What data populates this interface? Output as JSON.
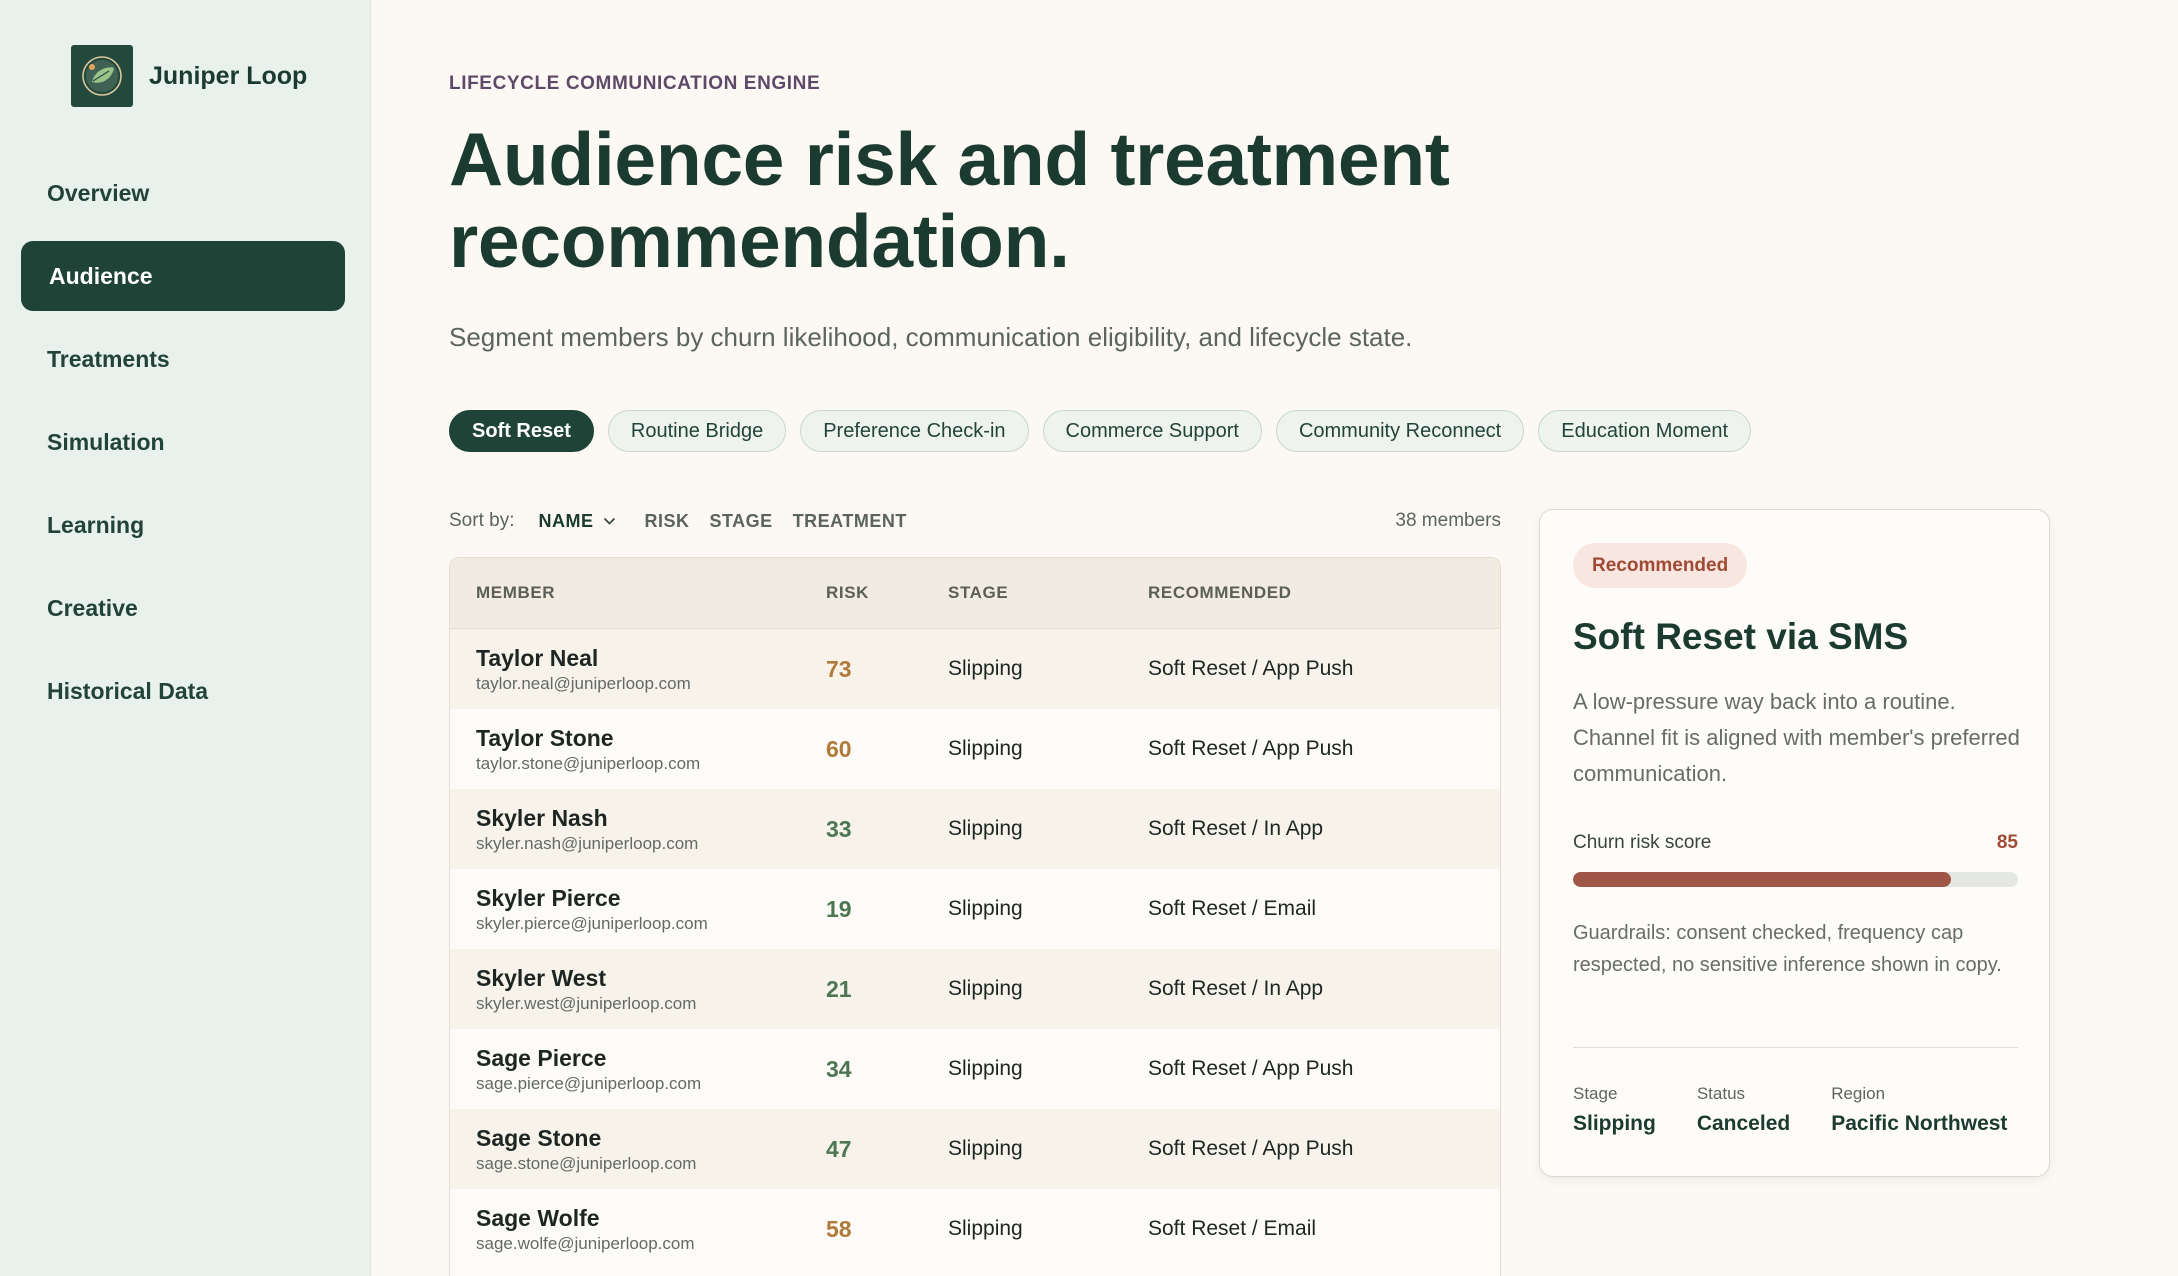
{
  "brand": {
    "name": "Juniper Loop"
  },
  "nav": {
    "items": [
      {
        "label": "Overview",
        "active": false
      },
      {
        "label": "Audience",
        "active": true
      },
      {
        "label": "Treatments",
        "active": false
      },
      {
        "label": "Simulation",
        "active": false
      },
      {
        "label": "Learning",
        "active": false
      },
      {
        "label": "Creative",
        "active": false
      },
      {
        "label": "Historical Data",
        "active": false
      }
    ]
  },
  "header": {
    "eyebrow": "LIFECYCLE COMMUNICATION ENGINE",
    "title": "Audience risk and treatment recommendation.",
    "subtitle": "Segment members by churn likelihood, communication eligibility, and lifecycle state."
  },
  "chips": [
    {
      "label": "Soft Reset",
      "active": true
    },
    {
      "label": "Routine Bridge",
      "active": false
    },
    {
      "label": "Preference Check-in",
      "active": false
    },
    {
      "label": "Commerce Support",
      "active": false
    },
    {
      "label": "Community Reconnect",
      "active": false
    },
    {
      "label": "Education Moment",
      "active": false
    }
  ],
  "sort": {
    "label": "Sort by:",
    "options": [
      "NAME",
      "RISK",
      "STAGE",
      "TREATMENT"
    ],
    "active": "NAME",
    "count": "38 members"
  },
  "table": {
    "headers": [
      "MEMBER",
      "RISK",
      "STAGE",
      "RECOMMENDED"
    ],
    "rows": [
      {
        "name": "Taylor Neal",
        "email": "taylor.neal@juniperloop.com",
        "risk": "73",
        "level": "high",
        "stage": "Slipping",
        "recommended": "Soft Reset / App Push"
      },
      {
        "name": "Taylor Stone",
        "email": "taylor.stone@juniperloop.com",
        "risk": "60",
        "level": "high",
        "stage": "Slipping",
        "recommended": "Soft Reset / App Push"
      },
      {
        "name": "Skyler Nash",
        "email": "skyler.nash@juniperloop.com",
        "risk": "33",
        "level": "low",
        "stage": "Slipping",
        "recommended": "Soft Reset / In App"
      },
      {
        "name": "Skyler Pierce",
        "email": "skyler.pierce@juniperloop.com",
        "risk": "19",
        "level": "low",
        "stage": "Slipping",
        "recommended": "Soft Reset / Email"
      },
      {
        "name": "Skyler West",
        "email": "skyler.west@juniperloop.com",
        "risk": "21",
        "level": "low",
        "stage": "Slipping",
        "recommended": "Soft Reset / In App"
      },
      {
        "name": "Sage Pierce",
        "email": "sage.pierce@juniperloop.com",
        "risk": "34",
        "level": "low",
        "stage": "Slipping",
        "recommended": "Soft Reset / App Push"
      },
      {
        "name": "Sage Stone",
        "email": "sage.stone@juniperloop.com",
        "risk": "47",
        "level": "low",
        "stage": "Slipping",
        "recommended": "Soft Reset / App Push"
      },
      {
        "name": "Sage Wolfe",
        "email": "sage.wolfe@juniperloop.com",
        "risk": "58",
        "level": "high",
        "stage": "Slipping",
        "recommended": "Soft Reset / Email"
      }
    ]
  },
  "card": {
    "badge": "Recommended",
    "title": "Soft Reset via SMS",
    "description": "A low-pressure way back into a routine. Channel fit is aligned with member's preferred communication.",
    "risk_label": "Churn risk score",
    "risk_value": "85",
    "risk_fraction": 0.85,
    "guardrails": "Guardrails: consent checked, frequency cap respected, no sensitive inference shown in copy.",
    "meta": [
      {
        "label": "Stage",
        "value": "Slipping"
      },
      {
        "label": "Status",
        "value": "Canceled"
      },
      {
        "label": "Region",
        "value": "Pacific Northwest"
      }
    ]
  },
  "colors": {
    "accent": "#1f4337",
    "risk_high": "#b07a3a",
    "risk_low": "#4d7655",
    "badge": "#a04a36"
  },
  "icons": {
    "brand": "leaf-logo-icon",
    "sort": "chevron-down-icon"
  }
}
